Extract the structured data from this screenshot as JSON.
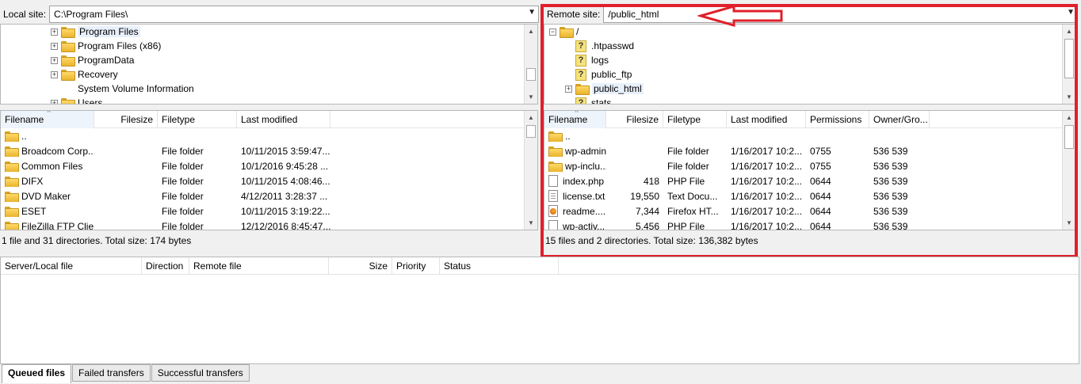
{
  "local": {
    "site_label": "Local site:",
    "path": "C:\\Program Files\\",
    "tree": [
      {
        "label": "Program Files",
        "selected": true
      },
      {
        "label": "Program Files (x86)"
      },
      {
        "label": "ProgramData"
      },
      {
        "label": "Recovery"
      },
      {
        "label": "System Volume Information",
        "no_expander": true
      },
      {
        "label": "Users"
      }
    ],
    "columns": [
      "Filename",
      "Filesize",
      "Filetype",
      "Last modified"
    ],
    "files": [
      {
        "name": "..",
        "size": "",
        "type": "",
        "modified": ""
      },
      {
        "name": "Broadcom Corp...",
        "size": "",
        "type": "File folder",
        "modified": "10/11/2015 3:59:47..."
      },
      {
        "name": "Common Files",
        "size": "",
        "type": "File folder",
        "modified": "10/1/2016 9:45:28 ..."
      },
      {
        "name": "DIFX",
        "size": "",
        "type": "File folder",
        "modified": "10/11/2015 4:08:46..."
      },
      {
        "name": "DVD Maker",
        "size": "",
        "type": "File folder",
        "modified": "4/12/2011 3:28:37 ..."
      },
      {
        "name": "ESET",
        "size": "",
        "type": "File folder",
        "modified": "10/11/2015 3:19:22..."
      },
      {
        "name": "FileZilla FTP Clie...",
        "size": "",
        "type": "File folder",
        "modified": "12/12/2016 8:45:47..."
      }
    ],
    "status": "1 file and 31 directories. Total size: 174 bytes"
  },
  "remote": {
    "site_label": "Remote site:",
    "path": "/public_html",
    "tree": [
      {
        "label": "/",
        "kind": "folder",
        "expander": "−",
        "indent": 0
      },
      {
        "label": ".htpasswd",
        "kind": "unknown",
        "indent": 1
      },
      {
        "label": "logs",
        "kind": "unknown",
        "indent": 1
      },
      {
        "label": "public_ftp",
        "kind": "unknown",
        "indent": 1
      },
      {
        "label": "public_html",
        "kind": "folder",
        "expander": "+",
        "indent": 1,
        "selected": true
      },
      {
        "label": "stats",
        "kind": "unknown",
        "indent": 1
      }
    ],
    "columns": [
      "Filename",
      "Filesize",
      "Filetype",
      "Last modified",
      "Permissions",
      "Owner/Gro..."
    ],
    "files": [
      {
        "name": "..",
        "size": "",
        "type": "",
        "modified": "",
        "perm": "",
        "owner": "",
        "icon": "folder"
      },
      {
        "name": "wp-admin",
        "size": "",
        "type": "File folder",
        "modified": "1/16/2017 10:2...",
        "perm": "0755",
        "owner": "536 539",
        "icon": "folder"
      },
      {
        "name": "wp-inclu...",
        "size": "",
        "type": "File folder",
        "modified": "1/16/2017 10:2...",
        "perm": "0755",
        "owner": "536 539",
        "icon": "folder"
      },
      {
        "name": "index.php",
        "size": "418",
        "type": "PHP File",
        "modified": "1/16/2017 10:2...",
        "perm": "0644",
        "owner": "536 539",
        "icon": "file"
      },
      {
        "name": "license.txt",
        "size": "19,550",
        "type": "Text Docu...",
        "modified": "1/16/2017 10:2...",
        "perm": "0644",
        "owner": "536 539",
        "icon": "text"
      },
      {
        "name": "readme....",
        "size": "7,344",
        "type": "Firefox HT...",
        "modified": "1/16/2017 10:2...",
        "perm": "0644",
        "owner": "536 539",
        "icon": "ff"
      },
      {
        "name": "wp-activ...",
        "size": "5,456",
        "type": "PHP File",
        "modified": "1/16/2017 10:2...",
        "perm": "0644",
        "owner": "536 539",
        "icon": "file"
      }
    ],
    "status": "15 files and 2 directories. Total size: 136,382 bytes"
  },
  "queue": {
    "columns": [
      "Server/Local file",
      "Direction",
      "Remote file",
      "Size",
      "Priority",
      "Status"
    ]
  },
  "tabs": [
    "Queued files",
    "Failed transfers",
    "Successful transfers"
  ],
  "colors": {
    "highlight": "#e0202b"
  }
}
